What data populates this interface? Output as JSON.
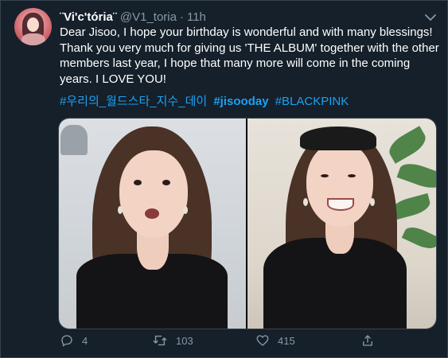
{
  "tweet": {
    "author": {
      "name": "¨Vi'c'tória¨",
      "handle": "@V1_toria",
      "separator": "·",
      "time": "11h"
    },
    "text": "Dear Jisoo, I hope your birthday is wonderful and with many blessings! Thank you very much for giving us 'THE ALBUM' together with the other members last year, I hope that many more will come in the coming years. I LOVE YOU!",
    "hashtags": [
      "#우리의_월드스타_지수_데이",
      "#jisooday",
      "#BLACKPINK"
    ],
    "icons": {
      "caret": "chevron-down-icon",
      "reply": "reply-icon",
      "retweet": "retweet-icon",
      "like": "heart-icon",
      "share": "share-icon"
    },
    "actions": {
      "reply_count": "4",
      "retweet_count": "103",
      "like_count": "415"
    }
  },
  "colors": {
    "background": "#15202b",
    "link": "#1da1f2",
    "muted": "#8899a6",
    "border": "#38444d"
  }
}
